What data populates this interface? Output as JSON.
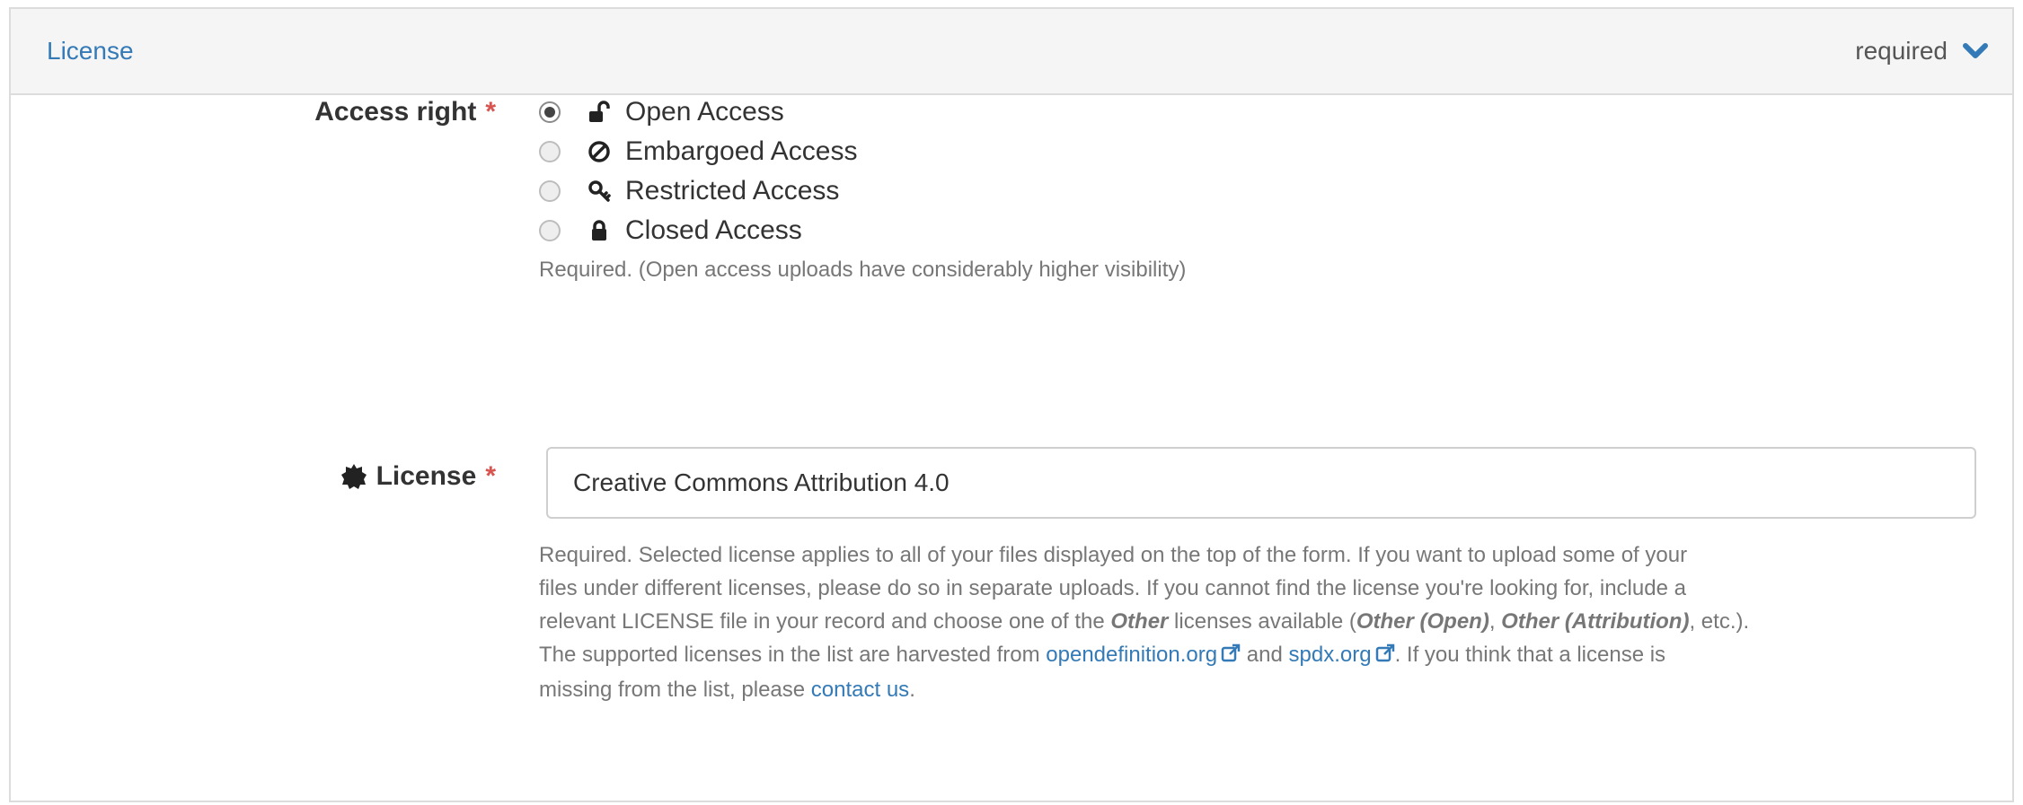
{
  "section": {
    "title": "License",
    "status": "required",
    "toggle_icon": "chevron-down-icon",
    "accent_color": "#337ab7"
  },
  "access_right": {
    "label": "Access right",
    "required_mark": "*",
    "selected": "Open Access",
    "options": [
      {
        "label": "Open Access",
        "icon": "unlock-icon",
        "checked": true
      },
      {
        "label": "Embargoed Access",
        "icon": "ban-icon",
        "checked": false
      },
      {
        "label": "Restricted Access",
        "icon": "key-icon",
        "checked": false
      },
      {
        "label": "Closed Access",
        "icon": "lock-icon",
        "checked": false
      }
    ],
    "help": "Required. (Open access uploads have considerably higher visibility)"
  },
  "license": {
    "label": "License",
    "label_icon": "certificate-icon",
    "required_mark": "*",
    "value": "Creative Commons Attribution 4.0",
    "help": {
      "line1": "Required. Selected license applies to all of your files displayed on the top of the form. If you want to upload some of your",
      "line2": "files under different licenses, please do so in separate uploads. If you cannot find the license you're looking for, include a",
      "line3_a": "relevant LICENSE file in your record and choose one of the ",
      "line3_other": "Other",
      "line3_b": " licenses available (",
      "line3_open": "Other (Open)",
      "line3_c": ", ",
      "line3_attr": "Other (Attribution)",
      "line3_d": ", etc.).",
      "line4_a": "The supported licenses in the list are harvested from ",
      "link_opendefinition": "opendefinition.org",
      "line4_and": " and ",
      "link_spdx": "spdx.org",
      "line4_b": ". If you think that a license is",
      "line5_a": "missing from the list, please ",
      "link_contact": "contact us",
      "line5_b": "."
    }
  }
}
